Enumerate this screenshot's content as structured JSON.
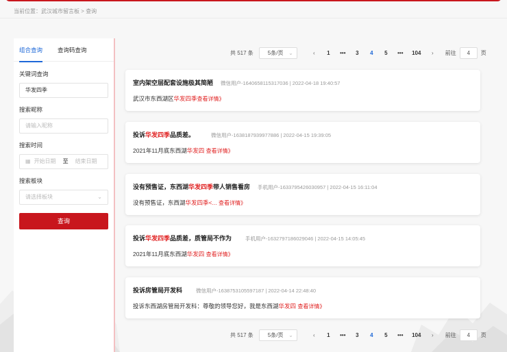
{
  "breadcrumb": {
    "text": "当前位置：武汉城市留言板 > 查询"
  },
  "left_panel": {
    "tabs": [
      {
        "label": "组合查询"
      },
      {
        "label": "查询码查询"
      }
    ],
    "keyword": {
      "label": "关键词查询",
      "value": "华发四季"
    },
    "nickname": {
      "label": "搜索昵称",
      "placeholder": "请输入昵称"
    },
    "time": {
      "label": "搜索时间",
      "start_placeholder": "开始日期",
      "separator": "至",
      "end_placeholder": "结束日期"
    },
    "board": {
      "label": "搜索板块",
      "placeholder": "请选择板块"
    },
    "query_button": "查询"
  },
  "pagination": {
    "total": "共 517 条",
    "page_size": "5条/页",
    "pages": [
      "1",
      "•••",
      "3",
      "4",
      "5",
      "•••",
      "104"
    ],
    "current": "4",
    "goto_label": "前往",
    "goto_value": "4",
    "page_word": "页"
  },
  "posts": [
    {
      "title_parts": [
        "室内架空层配套设施极其简陋",
        "",
        ""
      ],
      "meta": "微信用户-1640658115317036  |  2022-04-18 19:40:57",
      "body_parts": [
        "武汉市东西湖区",
        "华发四季",
        ""
      ],
      "more": "查看详情》"
    },
    {
      "title_parts": [
        "投诉",
        "华发四季",
        "品质差。"
      ],
      "meta": "微信用户-1638187939977886  |  2022-04-15 19:39:05",
      "body_parts": [
        "2021年11月底东西湖",
        "华发四",
        ""
      ],
      "more": "查看详情》"
    },
    {
      "title_parts": [
        "没有预售证，东西湖",
        "华发四季",
        "带人销售看房"
      ],
      "meta": "手机用户-1633795426030957  |  2022-04-15 16:11:04",
      "body_parts": [
        "没有预售证，东西湖",
        "华发四季",
        "<..."
      ],
      "more": "查看详情》"
    },
    {
      "title_parts": [
        "投诉",
        "华发四季",
        "品质差，质管局不作为"
      ],
      "meta": "手机用户-1632797186029046  |  2022-04-15 14:05:45",
      "body_parts": [
        "2021年11月底东西湖",
        "华发四",
        ""
      ],
      "more": "查看详情》"
    },
    {
      "title_parts": [
        "投诉房管局开发科",
        "",
        ""
      ],
      "meta": "微信用户-1638753105597187  |  2022-04-14 22:48:40",
      "body_parts": [
        "投诉东西湖房管局开发科：尊敬的领导您好，我是东西湖",
        "华发四",
        ""
      ],
      "more": "查看详情》"
    }
  ],
  "colors": {
    "brand_red": "#c8161d",
    "highlight": "#e02020",
    "tab_active": "#1e68d8"
  },
  "icons": {
    "calendar": "calendar-icon",
    "select_chevron": "chevron-down-icon",
    "prev": "chevron-left-icon",
    "next": "chevron-right-icon"
  }
}
